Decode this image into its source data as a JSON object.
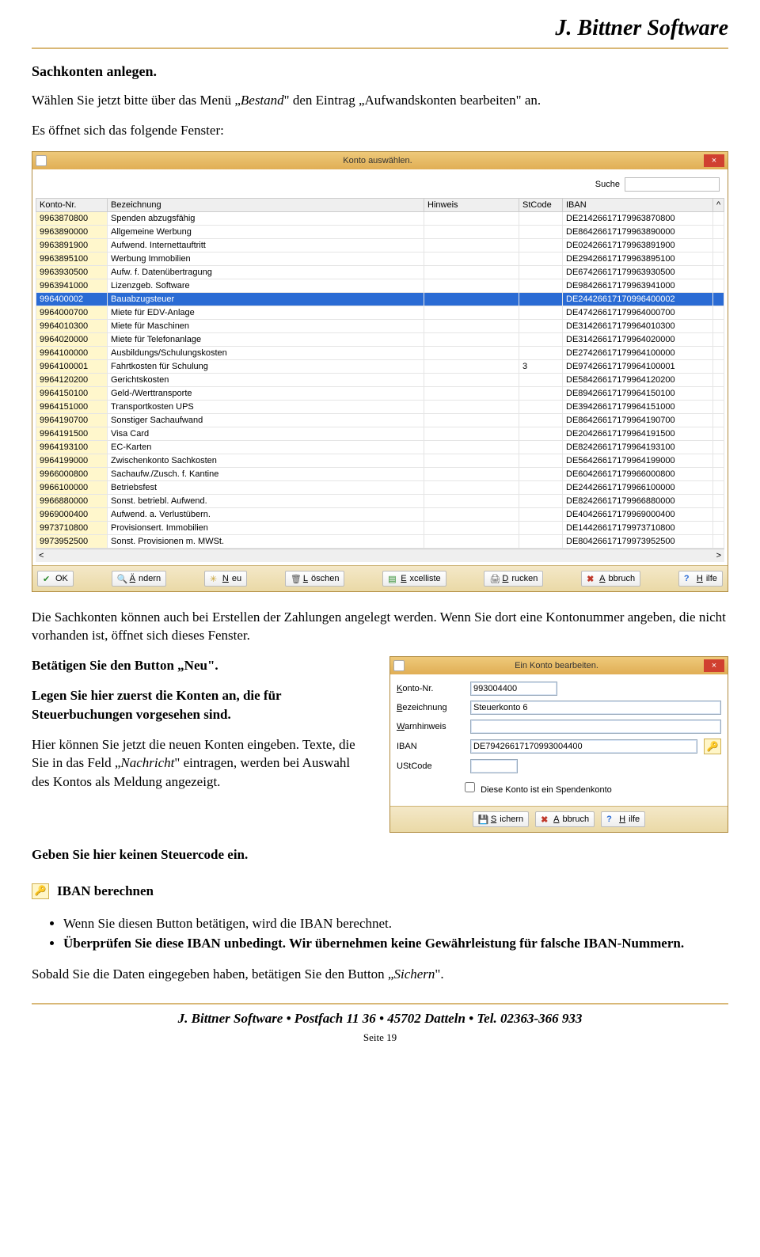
{
  "brand": "J. Bittner Software",
  "section_heading": "Sachkonten anlegen.",
  "intro_line_pre": "Wählen  Sie jetzt bitte über das Menü „",
  "intro_line_em": "Bestand",
  "intro_line_post": "\" den Eintrag „Aufwandskonten bearbeiten\" an.",
  "opener_line": "Es öffnet sich das folgende Fenster:",
  "win1": {
    "title": "Konto auswählen.",
    "search_label": "Suche",
    "search_value": "",
    "columns": [
      "Konto-Nr.",
      "Bezeichnung",
      "Hinweis",
      "StCode",
      "IBAN"
    ],
    "rows": [
      {
        "k": "9963870800",
        "b": "Spenden abzugsfähig",
        "h": "",
        "s": "",
        "i": "DE21426617179963870800"
      },
      {
        "k": "9963890000",
        "b": "Allgemeine Werbung",
        "h": "",
        "s": "",
        "i": "DE86426617179963890000"
      },
      {
        "k": "9963891900",
        "b": "Aufwend. Internettauftritt",
        "h": "",
        "s": "",
        "i": "DE02426617179963891900"
      },
      {
        "k": "9963895100",
        "b": "Werbung Immobilien",
        "h": "",
        "s": "",
        "i": "DE29426617179963895100"
      },
      {
        "k": "9963930500",
        "b": "Aufw. f. Datenübertragung",
        "h": "",
        "s": "",
        "i": "DE67426617179963930500"
      },
      {
        "k": "9963941000",
        "b": "Lizenzgeb. Software",
        "h": "",
        "s": "",
        "i": "DE98426617179963941000"
      },
      {
        "k": "996400002",
        "b": "Bauabzugsteuer",
        "h": "",
        "s": "",
        "i": "DE24426617170996400002",
        "sel": true
      },
      {
        "k": "9964000700",
        "b": "Miete für EDV-Anlage",
        "h": "",
        "s": "",
        "i": "DE47426617179964000700"
      },
      {
        "k": "9964010300",
        "b": "Miete für Maschinen",
        "h": "",
        "s": "",
        "i": "DE31426617179964010300"
      },
      {
        "k": "9964020000",
        "b": "Miete für Telefonanlage",
        "h": "",
        "s": "",
        "i": "DE31426617179964020000"
      },
      {
        "k": "9964100000",
        "b": "Ausbildungs/Schulungskosten",
        "h": "",
        "s": "",
        "i": "DE27426617179964100000"
      },
      {
        "k": "9964100001",
        "b": "Fahrtkosten für Schulung",
        "h": "",
        "s": "3",
        "i": "DE97426617179964100001"
      },
      {
        "k": "9964120200",
        "b": "Gerichtskosten",
        "h": "",
        "s": "",
        "i": "DE58426617179964120200"
      },
      {
        "k": "9964150100",
        "b": "Geld-/Werttransporte",
        "h": "",
        "s": "",
        "i": "DE89426617179964150100"
      },
      {
        "k": "9964151000",
        "b": "Transportkosten UPS",
        "h": "",
        "s": "",
        "i": "DE39426617179964151000"
      },
      {
        "k": "9964190700",
        "b": "Sonstiger Sachaufwand",
        "h": "",
        "s": "",
        "i": "DE86426617179964190700"
      },
      {
        "k": "9964191500",
        "b": "Visa Card",
        "h": "",
        "s": "",
        "i": "DE20426617179964191500"
      },
      {
        "k": "9964193100",
        "b": "EC-Karten",
        "h": "",
        "s": "",
        "i": "DE82426617179964193100"
      },
      {
        "k": "9964199000",
        "b": "Zwischenkonto Sachkosten",
        "h": "",
        "s": "",
        "i": "DE56426617179964199000"
      },
      {
        "k": "9966000800",
        "b": "Sachaufw./Zusch. f. Kantine",
        "h": "",
        "s": "",
        "i": "DE60426617179966000800"
      },
      {
        "k": "9966100000",
        "b": "Betriebsfest",
        "h": "",
        "s": "",
        "i": "DE24426617179966100000"
      },
      {
        "k": "9966880000",
        "b": "Sonst. betriebl. Aufwend.",
        "h": "",
        "s": "",
        "i": "DE82426617179966880000"
      },
      {
        "k": "9969000400",
        "b": "Aufwend. a. Verlustübern.",
        "h": "",
        "s": "",
        "i": "DE40426617179969000400"
      },
      {
        "k": "9973710800",
        "b": "Provisionsert. Immobilien",
        "h": "",
        "s": "",
        "i": "DE14426617179973710800"
      },
      {
        "k": "9973952500",
        "b": "Sonst. Provisionen m. MWSt.",
        "h": "",
        "s": "",
        "i": "DE80426617179973952500"
      }
    ],
    "buttons": {
      "ok": "OK",
      "aendern": "Ändern",
      "neu": "Neu",
      "loeschen": "Löschen",
      "excelliste": "Excelliste",
      "drucken": "Drucken",
      "abbruch": "Abbruch",
      "hilfe": "Hilfe"
    }
  },
  "mid_para": "Die Sachkonten können auch bei Erstellen der Zahlungen angelegt werden. Wenn Sie dort eine Kontonummer angeben, die nicht vorhanden ist, öffnet sich dieses Fenster.",
  "p_neu": "Betätigen Sie den Button „Neu\".",
  "p_legen": "Legen Sie hier zuerst die Konten an, die für Steuerbuchungen vorgesehen sind.",
  "p_hier_pre": "Hier können Sie jetzt die neuen Konten eingeben. Texte, die Sie in das Feld „",
  "p_hier_em": "Nachricht",
  "p_hier_post": "\" eintragen, werden bei Auswahl des Kontos als Meldung angezeigt.",
  "p_steuer": "Geben Sie hier keinen Steuercode ein.",
  "win2": {
    "title": "Ein Konto bearbeiten.",
    "labels": {
      "konto": "Konto-Nr.",
      "bez": "Bezeichnung",
      "warn": "Warnhinweis",
      "iban": "IBAN",
      "ust": "UStCode"
    },
    "values": {
      "konto": "993004400",
      "bez": "Steuerkonto 6",
      "warn": "",
      "iban": "DE79426617170993004400",
      "ust": ""
    },
    "checkbox": "Diese Konto ist ein Spendenkonto",
    "buttons": {
      "sichern": "Sichern",
      "abbruch": "Abbruch",
      "hilfe": "Hilfe"
    }
  },
  "iban_heading": "IBAN berechnen",
  "bullets": [
    "Wenn Sie diesen Button betätigen, wird die IBAN berechnet.",
    "Überprüfen Sie diese IBAN unbedingt. Wir übernehmen keine Gewährleistung für falsche IBAN-Nummern."
  ],
  "closing_pre": "Sobald Sie die Daten eingegeben haben, betätigen Sie den Button „",
  "closing_em": "Sichern",
  "closing_post": "\".",
  "footer": "J. Bittner Software • Postfach 11 36 •  45702 Datteln • Tel. 02363-366 933",
  "page_no": "Seite 19"
}
